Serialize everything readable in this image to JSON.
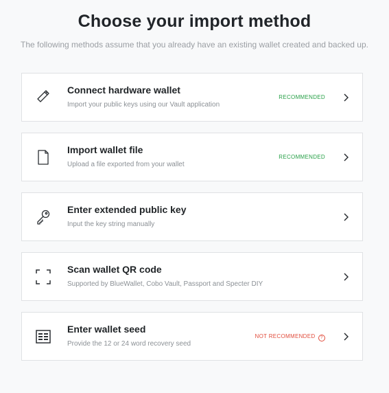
{
  "title": "Choose your import method",
  "subtitle": "The following methods assume that you already have an existing wallet created and backed up.",
  "methods": [
    {
      "name": "Connect hardware wallet",
      "desc": "Import your public keys using our Vault application",
      "badge": "RECOMMENDED",
      "icon": "usb-device-icon"
    },
    {
      "name": "Import wallet file",
      "desc": "Upload a file exported from your wallet",
      "badge": "RECOMMENDED",
      "icon": "file-icon"
    },
    {
      "name": "Enter extended public key",
      "desc": "Input the key string manually",
      "badge": "",
      "icon": "key-icon"
    },
    {
      "name": "Scan wallet QR code",
      "desc": "Supported by BlueWallet, Cobo Vault, Passport and Specter DIY",
      "badge": "",
      "icon": "scan-icon"
    },
    {
      "name": "Enter wallet seed",
      "desc": "Provide the 12 or 24 word recovery seed",
      "badge": "NOT RECOMMENDED",
      "badge_help": "?",
      "icon": "seed-grid-icon"
    }
  ],
  "colors": {
    "recommended": "#27a047",
    "not_recommended": "#e14b3b"
  }
}
